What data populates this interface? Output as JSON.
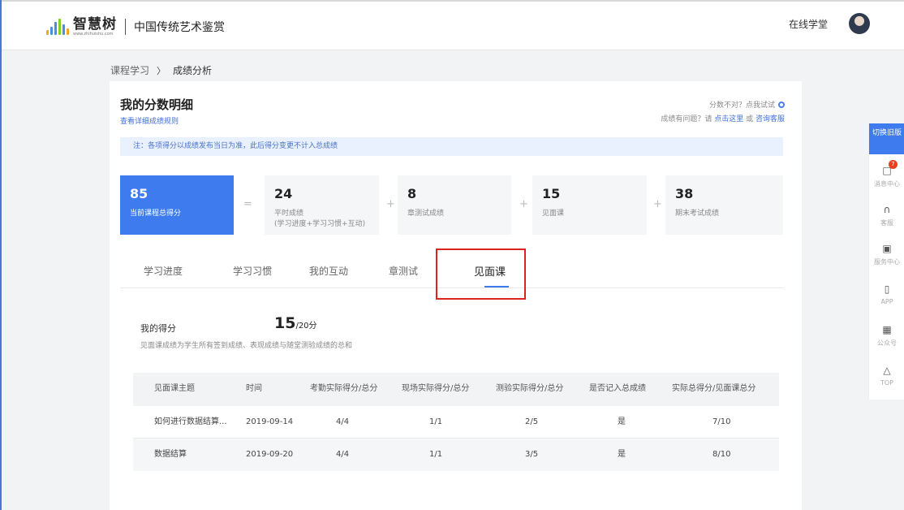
{
  "header": {
    "logo_text": "智慧树",
    "logo_sub": "www.zhihuishu.com",
    "course_title": "中国传统艺术鉴赏",
    "online_school": "在线学堂",
    "brand_color": "#3d7bef"
  },
  "breadcrumb": {
    "parent": "课程学习",
    "separator": "〉",
    "current": "成绩分析"
  },
  "card": {
    "title": "我的分数明细",
    "rules_link": "查看详细成绩规则",
    "score_wrong": "分数不对？点我试试",
    "problem_prefix": "成绩有问题？请",
    "problem_link1": "点击这里",
    "problem_or": "或",
    "problem_link2": "咨询客服",
    "notice": "注：各项得分以成绩发布当日为准，此后得分变更不计入总成绩"
  },
  "scores": {
    "total": {
      "value": "85",
      "label": "当前课程总得分"
    },
    "eq": "=",
    "plus": "+",
    "usual": {
      "value": "24",
      "label": "平时成绩",
      "sub": "(学习进度+学习习惯+互动)"
    },
    "chapter": {
      "value": "8",
      "label": "章测试成绩"
    },
    "meeting": {
      "value": "15",
      "label": "见面课"
    },
    "final": {
      "value": "38",
      "label": "期末考试成绩"
    }
  },
  "tabs": [
    "学习进度",
    "学习习惯",
    "我的互动",
    "章测试",
    "见面课"
  ],
  "active_tab": "见面课",
  "my_score": {
    "label": "我的得分",
    "value": "15",
    "total": "/20分",
    "desc": "见面课成绩为学生所有签到成绩、表现成绩与随堂测验成绩的总和"
  },
  "table": {
    "headers": [
      "见面课主题",
      "时间",
      "考勤实际得分/总分",
      "现场实际得分/总分",
      "测验实际得分/总分",
      "是否记入总成绩",
      "实际总得分/见面课总分"
    ],
    "rows": [
      [
        "如何进行数据结算...",
        "2019-09-14",
        "4/4",
        "1/1",
        "2/5",
        "是",
        "7/10"
      ],
      [
        "数据结算",
        "2019-09-20",
        "4/4",
        "1/1",
        "3/5",
        "是",
        "8/10"
      ]
    ]
  },
  "sidebar": {
    "switch_old": "切换旧版",
    "items": [
      {
        "label": "消息中心",
        "icon": "message-icon",
        "badge": "7"
      },
      {
        "label": "客服",
        "icon": "headset-icon"
      },
      {
        "label": "服务中心",
        "icon": "service-icon"
      },
      {
        "label": "APP",
        "icon": "phone-icon"
      },
      {
        "label": "公众号",
        "icon": "qrcode-icon"
      },
      {
        "label": "TOP",
        "icon": "up-triangle-icon"
      }
    ]
  }
}
